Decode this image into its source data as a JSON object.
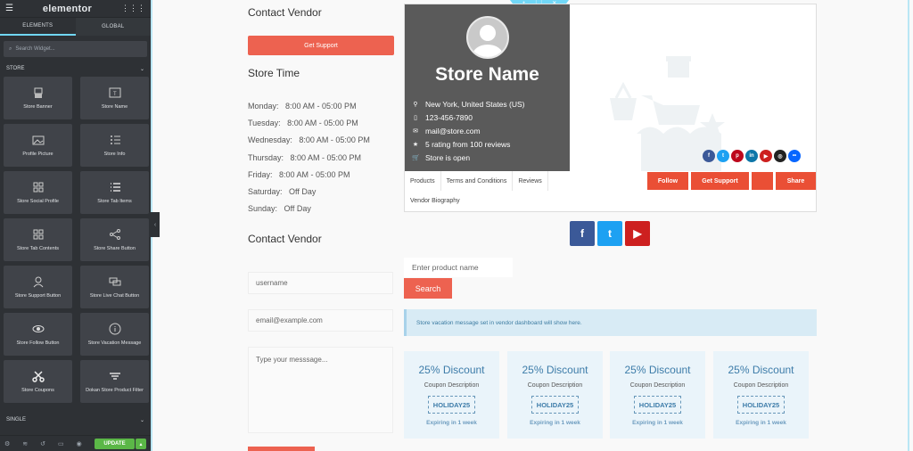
{
  "panel": {
    "logo": "elementor",
    "tabs": [
      "ELEMENTS",
      "GLOBAL"
    ],
    "search_placeholder": "Search Widget...",
    "section_store": "STORE",
    "section_single": "SINGLE",
    "widgets": [
      {
        "label": "Store Banner",
        "icon": "banner-icon"
      },
      {
        "label": "Store Name",
        "icon": "text-icon"
      },
      {
        "label": "Profile Picture",
        "icon": "image-icon"
      },
      {
        "label": "Store Info",
        "icon": "list-icon"
      },
      {
        "label": "Store Social Profile",
        "icon": "social-icon"
      },
      {
        "label": "Store Tab Items",
        "icon": "bullet-list-icon"
      },
      {
        "label": "Store Tab Contents",
        "icon": "grid-icon"
      },
      {
        "label": "Store Share Button",
        "icon": "share-icon"
      },
      {
        "label": "Store Support Button",
        "icon": "support-icon"
      },
      {
        "label": "Store Live Chat Button",
        "icon": "chat-icon"
      },
      {
        "label": "Store Follow Button",
        "icon": "eye-icon"
      },
      {
        "label": "Store Vacation Message",
        "icon": "info-icon"
      },
      {
        "label": "Store Coupons",
        "icon": "scissors-icon"
      },
      {
        "label": "Dokan Store Product Filter",
        "icon": "filter-icon"
      }
    ],
    "update_label": "UPDATE"
  },
  "contact_top": {
    "title": "Contact Vendor",
    "button": "Get Support"
  },
  "store_time": {
    "title": "Store Time",
    "hours": [
      "Monday:   8:00 AM - 05:00 PM",
      "Tuesday:   8:00 AM - 05:00 PM",
      "Wednesday:   8:00 AM - 05:00 PM",
      "Thursday:   8:00 AM - 05:00 PM",
      "Friday:   8:00 AM - 05:00 PM",
      "Saturday:   Off Day",
      "Sunday:   Off Day"
    ]
  },
  "contact_form": {
    "title": "Contact Vendor",
    "username_placeholder": "username",
    "email_placeholder": "email@example.com",
    "message_placeholder": "Type your messsage..."
  },
  "profile": {
    "store_name": "Store Name",
    "info": [
      {
        "icon": "location-icon",
        "text": "New York, United States (US)"
      },
      {
        "icon": "phone-icon",
        "text": "123-456-7890"
      },
      {
        "icon": "mail-icon",
        "text": "mail@store.com"
      },
      {
        "icon": "star-icon",
        "text": "5 rating from 100 reviews"
      },
      {
        "icon": "cart-icon",
        "text": "Store is open"
      }
    ],
    "tabs": [
      "Products",
      "Terms and Conditions",
      "Reviews"
    ],
    "tab2": "Vendor Biography",
    "actions": [
      "Follow",
      "Get Support",
      "",
      "Share"
    ],
    "social_colors": [
      "#3b5998",
      "#1da1f2",
      "#bd081c",
      "#0e76a8",
      "#cd201f",
      "#222222",
      "#0866ff"
    ]
  },
  "social_buttons": [
    {
      "name": "facebook",
      "color": "#3b5998"
    },
    {
      "name": "twitter",
      "color": "#1da1f2"
    },
    {
      "name": "youtube",
      "color": "#cd201f"
    }
  ],
  "product_search": {
    "placeholder": "Enter product name",
    "button": "Search"
  },
  "vacation_message": "Store vacation message set in vendor dashboard will show here.",
  "coupons": [
    {
      "title": "25% Discount",
      "desc": "Coupon Description",
      "code": "HOLIDAY25",
      "expiry": "Expiring in 1 week"
    },
    {
      "title": "25% Discount",
      "desc": "Coupon Description",
      "code": "HOLIDAY25",
      "expiry": "Expiring in 1 week"
    },
    {
      "title": "25% Discount",
      "desc": "Coupon Description",
      "code": "HOLIDAY25",
      "expiry": "Expiring in 1 week"
    },
    {
      "title": "25% Discount",
      "desc": "Coupon Description",
      "code": "HOLIDAY25",
      "expiry": "Expiring in 1 week"
    }
  ]
}
